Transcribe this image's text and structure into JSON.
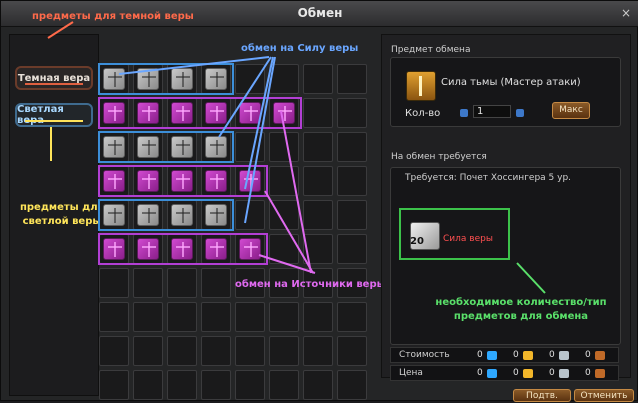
{
  "window": {
    "title": "Обмен",
    "close": "×"
  },
  "annotations": {
    "dark_faith_items": "предметы для темной веры",
    "light_faith_items": "предметы для светлой веры",
    "exchange_for_power": "обмен на Силу веры",
    "exchange_for_sources": "обмен на Источники веры",
    "needed_qty": "необходимое количество/тип предметов для обмена"
  },
  "tabs": [
    {
      "label": "Темная вера"
    },
    {
      "label": "Светлая вера"
    }
  ],
  "grid": {
    "cols": 8,
    "rows": 10,
    "rows_data": [
      [
        "gray",
        "gray",
        "gray",
        "gray",
        "",
        "",
        "",
        ""
      ],
      [
        "pink",
        "pink",
        "pink",
        "pink",
        "pink",
        "pink",
        "",
        ""
      ],
      [
        "gray",
        "gray",
        "gray",
        "gray",
        "",
        "",
        "",
        ""
      ],
      [
        "pink",
        "pink",
        "pink",
        "pink",
        "pink",
        "",
        "",
        ""
      ],
      [
        "gray",
        "gray",
        "gray",
        "gray",
        "",
        "",
        "",
        ""
      ],
      [
        "pink",
        "pink",
        "pink",
        "pink",
        "pink",
        "",
        "",
        ""
      ],
      [
        "",
        "",
        "",
        "",
        "",
        "",
        "",
        ""
      ],
      [
        "",
        "",
        "",
        "",
        "",
        "",
        "",
        ""
      ],
      [
        "",
        "",
        "",
        "",
        "",
        "",
        "",
        ""
      ],
      [
        "",
        "",
        "",
        "",
        "",
        "",
        "",
        ""
      ]
    ]
  },
  "exchange_item": {
    "section_label": "Предмет обмена",
    "name": "Сила тьмы (Мастер атаки)",
    "qty_label": "Кол-во",
    "qty_value": "1",
    "max_label": "Макс"
  },
  "requirement": {
    "section_label": "На обмен требуется",
    "text": "Требуется: Почет Хоссингера 5 ур.",
    "item_count": "20",
    "item_name": "Сила веры"
  },
  "costs": {
    "rows": [
      {
        "label": "Стоимость",
        "values": [
          "0",
          "0",
          "0",
          "0"
        ]
      },
      {
        "label": "Цена",
        "values": [
          "0",
          "0",
          "0",
          "0"
        ]
      }
    ]
  },
  "buttons": {
    "confirm": "Подтв.",
    "cancel": "Отменить"
  },
  "colors": {
    "annot_red": "#ff6a4a",
    "annot_yellow": "#ffe55a",
    "annot_blue": "#6aa6ff",
    "annot_purple": "#e06af0",
    "annot_green": "#5ae06a"
  }
}
